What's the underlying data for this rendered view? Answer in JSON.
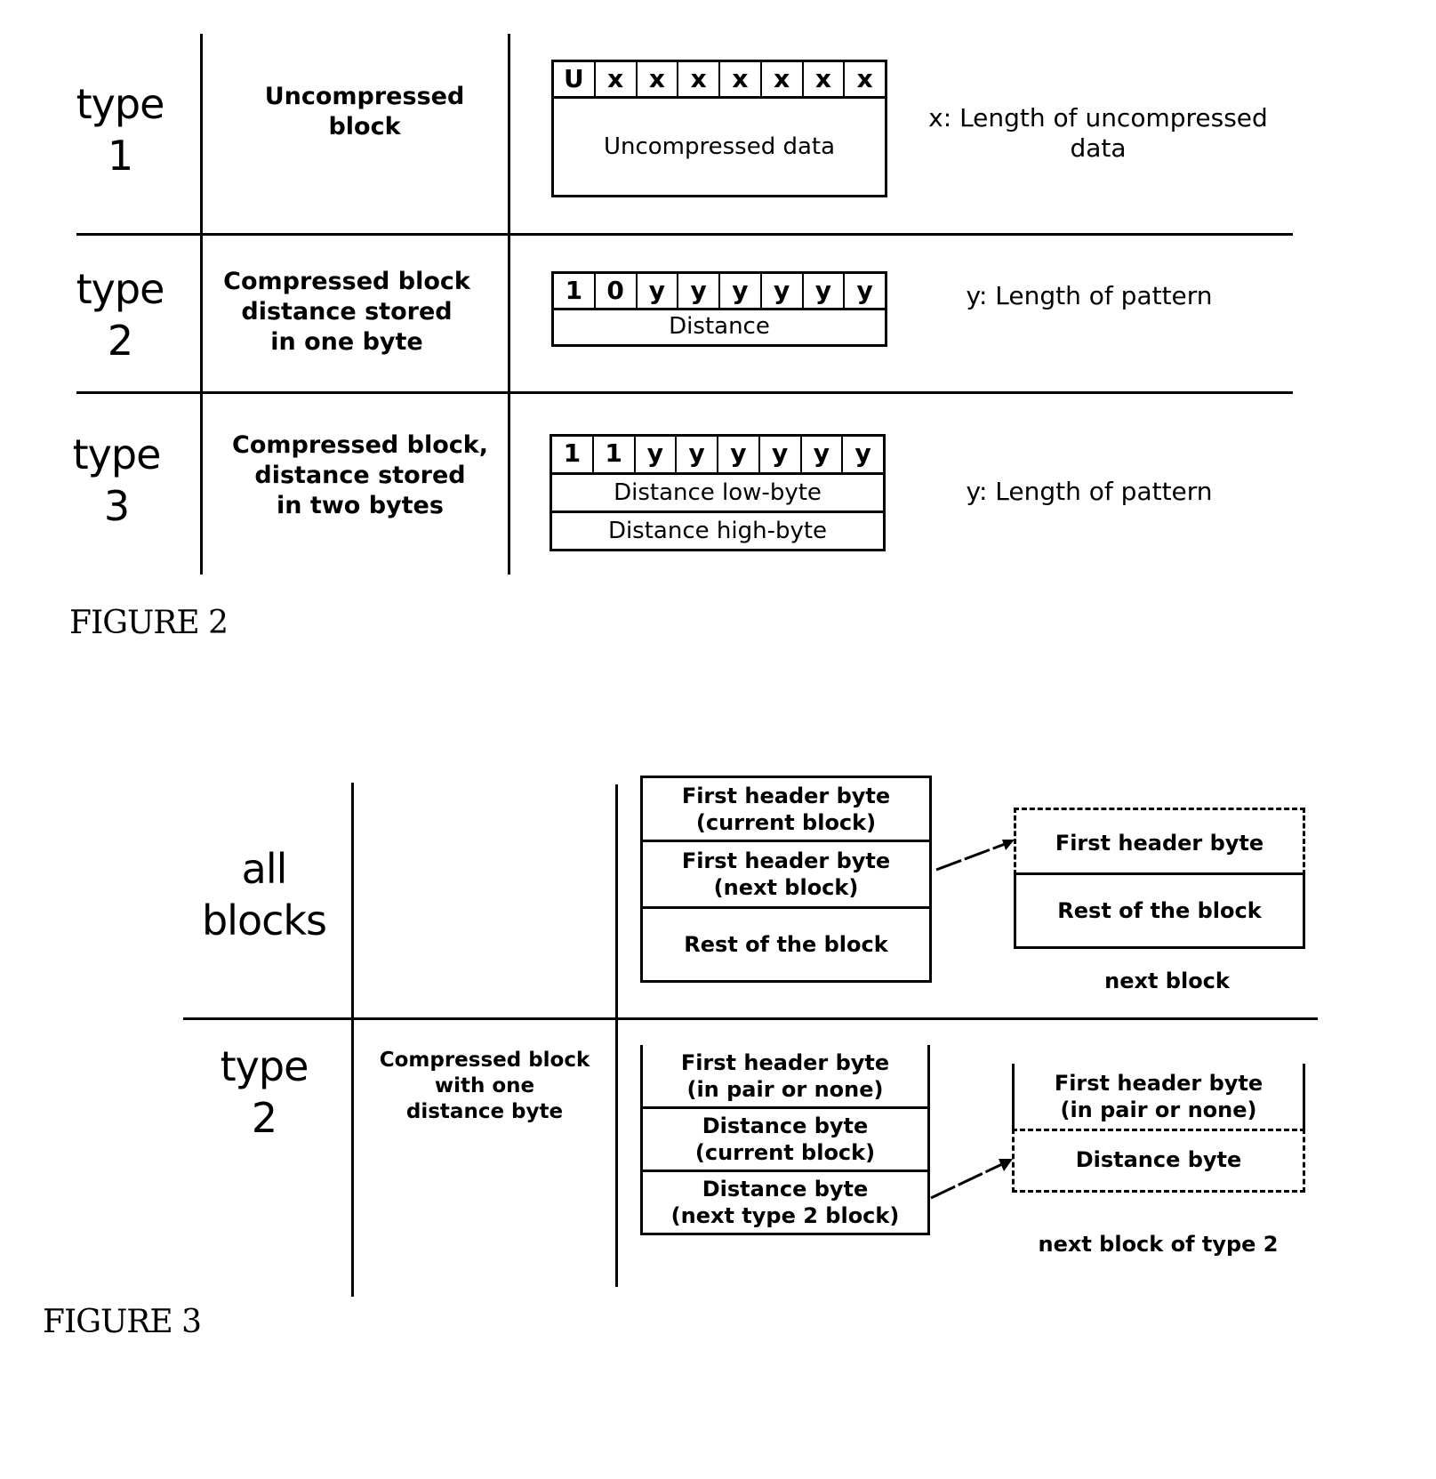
{
  "figure2": {
    "caption": "FIGURE 2",
    "rows": [
      {
        "type_word": "type",
        "type_num": "1",
        "description": [
          "Uncompressed",
          "block"
        ],
        "bits": [
          "U",
          "x",
          "x",
          "x",
          "x",
          "x",
          "x",
          "x"
        ],
        "fields": [
          "Uncompressed data"
        ],
        "note": [
          "x: Length of uncompressed",
          "data"
        ]
      },
      {
        "type_word": "type",
        "type_num": "2",
        "description": [
          "Compressed block",
          "distance stored",
          "in one byte"
        ],
        "bits": [
          "1",
          "0",
          "y",
          "y",
          "y",
          "y",
          "y",
          "y"
        ],
        "fields": [
          "Distance"
        ],
        "note": [
          "y: Length of pattern"
        ]
      },
      {
        "type_word": "type",
        "type_num": "3",
        "description": [
          "Compressed block,",
          "distance stored",
          "in two bytes"
        ],
        "bits": [
          "1",
          "1",
          "y",
          "y",
          "y",
          "y",
          "y",
          "y"
        ],
        "fields": [
          "Distance low-byte",
          "Distance high-byte"
        ],
        "note": [
          "y: Length of pattern"
        ]
      }
    ]
  },
  "figure3": {
    "caption": "FIGURE 3",
    "rows": [
      {
        "type_word": "all",
        "type_num": "blocks",
        "description": [],
        "current_block": [
          [
            "First header byte",
            "(current block)"
          ],
          [
            "First header byte",
            "(next block)"
          ],
          [
            "Rest of the block"
          ]
        ],
        "next_block": [
          [
            "First header byte"
          ],
          [
            "Rest of the block"
          ]
        ],
        "next_label": "next block"
      },
      {
        "type_word": "type",
        "type_num": "2",
        "description": [
          "Compressed block",
          "with one",
          "distance byte"
        ],
        "current_block": [
          [
            "First header byte",
            "(in pair or none)"
          ],
          [
            "Distance byte",
            "(current block)"
          ],
          [
            "Distance byte",
            "(next type 2 block)"
          ]
        ],
        "next_block": [
          [
            "First header byte",
            "(in pair or none)"
          ],
          [
            "Distance byte"
          ]
        ],
        "next_label": "next block of type 2"
      }
    ]
  }
}
